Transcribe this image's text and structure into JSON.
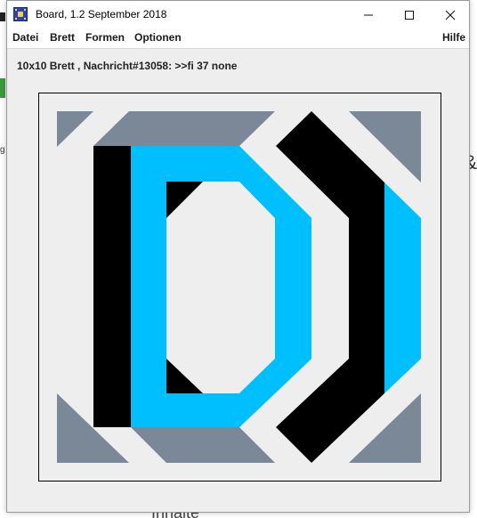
{
  "window": {
    "title": "Board, 1.2 September 2018"
  },
  "menu": {
    "items": [
      "Datei",
      "Brett",
      "Formen",
      "Optionen"
    ],
    "help": "Hilfe"
  },
  "status": {
    "text": "10x10 Brett , Nachricht#13058: >>fi 37 none"
  },
  "board": {
    "grid_size": "10x10",
    "colors": {
      "background": "#eeeeee",
      "gray": "#7a8897",
      "black": "#000000",
      "cyan": "#00bfff"
    }
  },
  "background_fragments": {
    "left": [
      "g"
    ],
    "right": [
      "&"
    ],
    "bottom": "Inhalte"
  },
  "icons": {
    "app": "board-app-icon",
    "minimize": "minimize-icon",
    "maximize": "maximize-icon",
    "close": "close-icon"
  }
}
